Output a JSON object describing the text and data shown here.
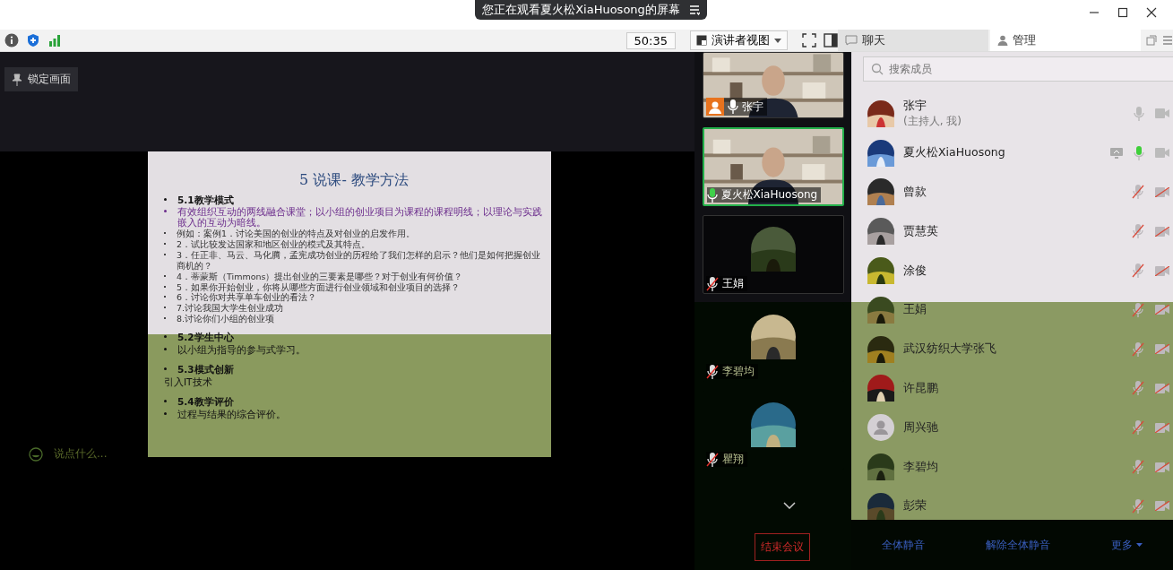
{
  "banner": {
    "text": "您正在观看夏火松XiaHuosong的屏幕"
  },
  "toolbar": {
    "timer": "50:35",
    "view_menu": "演讲者视图"
  },
  "tabs": [
    {
      "label": "聊天",
      "selected": false
    },
    {
      "label": "管理",
      "selected": true
    }
  ],
  "stage": {
    "lock_button": "锁定画面",
    "chat_placeholder": "说点什么...",
    "slide": {
      "title": "5 说课- 教学方法",
      "items": [
        {
          "kind": "heading",
          "text": "5.1教学模式"
        },
        {
          "kind": "highlight",
          "text": "有效组织互动的两线融合课堂；以小组的创业项目为课程的课程明线；以理论与实践嵌入的互动为暗线。"
        },
        {
          "kind": "small",
          "text": "例如：案例1．讨论美国的创业的特点及对创业的启发作用。"
        },
        {
          "kind": "small",
          "text": "2．试比较发达国家和地区创业的模式及其特点。"
        },
        {
          "kind": "small",
          "text": "3．任正非、马云、马化腾，孟宪成功创业的历程给了我们怎样的启示？他们是如何把握创业商机的？"
        },
        {
          "kind": "small",
          "text": "4．蒂蒙斯（Timmons）提出创业的三要素是哪些？对于创业有何价值？"
        },
        {
          "kind": "small",
          "text": "5．如果你开始创业，你将从哪些方面进行创业领域和创业项目的选择？"
        },
        {
          "kind": "small",
          "text": "6．讨论你对共享单车创业的看法？"
        },
        {
          "kind": "small",
          "text": "7.讨论我国大学生创业成功"
        },
        {
          "kind": "small",
          "text": "8.讨论你们小组的创业项"
        },
        {
          "kind": "heading",
          "text": "5.2学生中心"
        },
        {
          "kind": "bullet",
          "text": "以小组为指导的参与式学习。"
        },
        {
          "kind": "heading",
          "text": "5.3模式创新"
        },
        {
          "kind": "plain",
          "text": "引入IT技术"
        },
        {
          "kind": "heading",
          "text": "5.4教学评价"
        },
        {
          "kind": "bullet",
          "text": "过程与结果的综合评价。"
        }
      ]
    }
  },
  "videos": [
    {
      "name": "张宇",
      "kind": "video",
      "muted": false,
      "host": true,
      "speaking": false
    },
    {
      "name": "夏火松XiaHuosong",
      "kind": "video",
      "muted": false,
      "host": false,
      "speaking": true
    },
    {
      "name": "王娟",
      "kind": "avatar",
      "muted": true,
      "host": false,
      "speaking": false
    },
    {
      "name": "李碧均",
      "kind": "avatar",
      "muted": true,
      "host": false,
      "speaking": false
    },
    {
      "name": "瞿翔",
      "kind": "avatar",
      "muted": true,
      "host": false,
      "speaking": false
    }
  ],
  "end_button": "结束会议",
  "members": {
    "search_placeholder": "搜索成员",
    "list": [
      {
        "name": "张宇",
        "role": "(主持人, 我)",
        "sharing": false,
        "muted": false,
        "speaking": false,
        "camera_off": false
      },
      {
        "name": "夏火松XiaHuosong",
        "sharing": true,
        "muted": false,
        "speaking": true,
        "camera_off": false
      },
      {
        "name": "曾款",
        "sharing": false,
        "muted": true,
        "camera_off": true
      },
      {
        "name": "贾慧英",
        "sharing": false,
        "muted": true,
        "camera_off": true
      },
      {
        "name": "涂俊",
        "sharing": false,
        "muted": true,
        "camera_off": true
      },
      {
        "name": "王娟",
        "sharing": false,
        "muted": true,
        "camera_off": true
      },
      {
        "name": "武汉纺织大学张飞",
        "sharing": false,
        "muted": true,
        "camera_off": true
      },
      {
        "name": "许昆鹏",
        "sharing": false,
        "muted": true,
        "camera_off": true
      },
      {
        "name": "周兴驰",
        "kind": "default",
        "sharing": false,
        "muted": true,
        "camera_off": true
      },
      {
        "name": "李碧均",
        "sharing": false,
        "muted": true,
        "camera_off": true
      },
      {
        "name": "彭荣",
        "sharing": false,
        "muted": true,
        "camera_off": true
      }
    ],
    "actions": [
      {
        "label": "全体静音",
        "menu": false
      },
      {
        "label": "解除全体静音",
        "menu": false
      },
      {
        "label": "更多",
        "menu": true
      }
    ]
  }
}
